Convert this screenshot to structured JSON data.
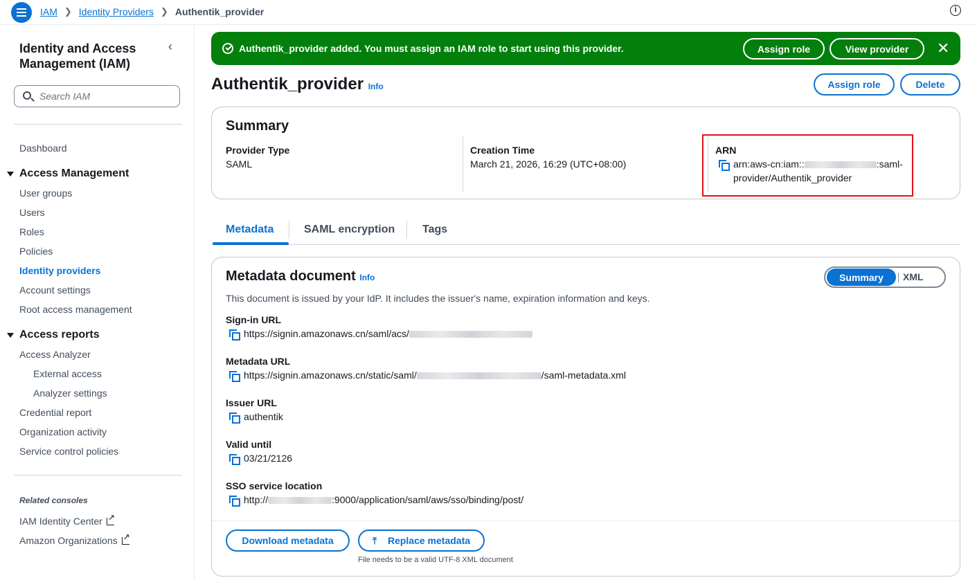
{
  "breadcrumb": {
    "items": [
      "IAM",
      "Identity Providers"
    ],
    "current": "Authentik_provider"
  },
  "sidebar": {
    "title": "Identity and Access Management (IAM)",
    "search_placeholder": "Search IAM",
    "dashboard": "Dashboard",
    "access_management": {
      "heading": "Access Management",
      "items": [
        "User groups",
        "Users",
        "Roles",
        "Policies",
        "Identity providers",
        "Account settings",
        "Root access management"
      ],
      "active": "Identity providers"
    },
    "access_reports": {
      "heading": "Access reports",
      "analyzer": "Access Analyzer",
      "analyzer_sub": [
        "External access",
        "Analyzer settings"
      ],
      "items": [
        "Credential report",
        "Organization activity",
        "Service control policies"
      ]
    },
    "related_heading": "Related consoles",
    "related": [
      "IAM Identity Center",
      "Amazon Organizations"
    ]
  },
  "flash": {
    "message": "Authentik_provider added. You must assign an IAM role to start using this provider.",
    "assign_role": "Assign role",
    "view_provider": "View provider",
    "status_color": "#037f0c"
  },
  "page": {
    "title": "Authentik_provider",
    "info": "Info",
    "assign_role": "Assign role",
    "delete": "Delete"
  },
  "summary": {
    "title": "Summary",
    "provider_type_label": "Provider Type",
    "provider_type": "SAML",
    "creation_time_label": "Creation Time",
    "creation_time": "March 21, 2026, 16:29 (UTC+08:00)",
    "arn_label": "ARN",
    "arn_prefix": "arn:aws-cn:iam::",
    "arn_mid": ":saml-",
    "arn_line2": "provider/Authentik_provider",
    "highlight_color": "#e0101a"
  },
  "tabs": {
    "items": [
      "Metadata",
      "SAML encryption",
      "Tags"
    ],
    "active": "Metadata"
  },
  "metadata": {
    "title": "Metadata document",
    "info": "Info",
    "view_summary": "Summary",
    "view_xml": "XML",
    "description": "This document is issued by your IdP. It includes the issuer's name, expiration information and keys.",
    "signin_label": "Sign-in URL",
    "signin_prefix": "https://signin.amazonaws.cn/saml/acs/",
    "metadata_url_label": "Metadata URL",
    "metadata_url_prefix": "https://signin.amazonaws.cn/static/saml/",
    "metadata_url_suffix": "/saml-metadata.xml",
    "issuer_label": "Issuer URL",
    "issuer": "authentik",
    "valid_label": "Valid until",
    "valid": "03/21/2126",
    "sso_label": "SSO service location",
    "sso_prefix": "http://",
    "sso_suffix": ":9000/application/saml/aws/sso/binding/post/",
    "download": "Download metadata",
    "replace": "Replace metadata",
    "note": "File needs to be a valid UTF-8 XML document"
  }
}
